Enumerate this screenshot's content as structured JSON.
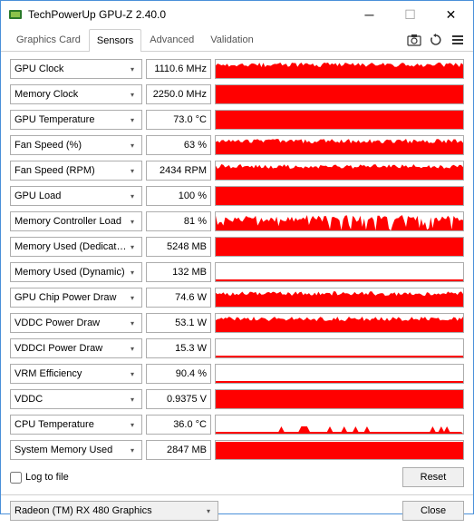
{
  "window": {
    "title": "TechPowerUp GPU-Z 2.40.0"
  },
  "tabs": [
    "Graphics Card",
    "Sensors",
    "Advanced",
    "Validation"
  ],
  "active_tab": 1,
  "sensors": [
    {
      "label": "GPU Clock",
      "value": "1110.6 MHz",
      "graph": "noisy_high"
    },
    {
      "label": "Memory Clock",
      "value": "2250.0 MHz",
      "graph": "full"
    },
    {
      "label": "GPU Temperature",
      "value": "73.0 °C",
      "graph": "full"
    },
    {
      "label": "Fan Speed (%)",
      "value": "63 %",
      "graph": "noisy_high"
    },
    {
      "label": "Fan Speed (RPM)",
      "value": "2434 RPM",
      "graph": "noisy_high"
    },
    {
      "label": "GPU Load",
      "value": "100 %",
      "graph": "full"
    },
    {
      "label": "Memory Controller Load",
      "value": "81 %",
      "graph": "noisy_high_spikes"
    },
    {
      "label": "Memory Used (Dedicated)",
      "value": "5248 MB",
      "graph": "full"
    },
    {
      "label": "Memory Used (Dynamic)",
      "value": "132 MB",
      "graph": "thin"
    },
    {
      "label": "GPU Chip Power Draw",
      "value": "74.6 W",
      "graph": "noisy_high"
    },
    {
      "label": "VDDC Power Draw",
      "value": "53.1 W",
      "graph": "noisy_high"
    },
    {
      "label": "VDDCI Power Draw",
      "value": "15.3 W",
      "graph": "thin"
    },
    {
      "label": "VRM Efficiency",
      "value": "90.4 %",
      "graph": "thin"
    },
    {
      "label": "VDDC",
      "value": "0.9375 V",
      "graph": "full"
    },
    {
      "label": "CPU Temperature",
      "value": "36.0 °C",
      "graph": "sparse_low"
    },
    {
      "label": "System Memory Used",
      "value": "2847 MB",
      "graph": "full_thin"
    }
  ],
  "log_label": "Log to file",
  "reset_label": "Reset",
  "gpu_select": "Radeon (TM) RX 480 Graphics",
  "close_label": "Close"
}
